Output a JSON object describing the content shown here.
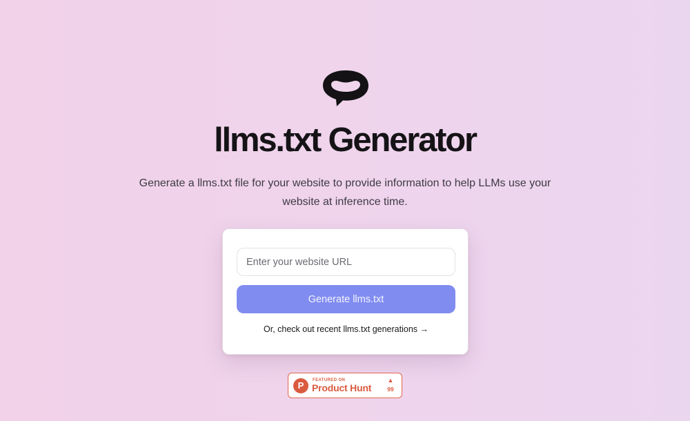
{
  "header": {
    "title": "llms.txt Generator",
    "subtitle": "Generate a llms.txt file for your website to provide information to help LLMs use your website at inference time."
  },
  "form": {
    "url_placeholder": "Enter your website URL",
    "url_value": "",
    "generate_label": "Generate llms.txt",
    "recent_link_label": "Or, check out recent llms.txt generations →"
  },
  "product_hunt": {
    "logo_letter": "P",
    "featured_label": "FEATURED ON",
    "name": "Product Hunt",
    "upvote_arrow": "▲",
    "upvote_count": "99"
  },
  "colors": {
    "accent": "#818cf0",
    "product_hunt": "#da5b3f",
    "text": "#151316"
  }
}
